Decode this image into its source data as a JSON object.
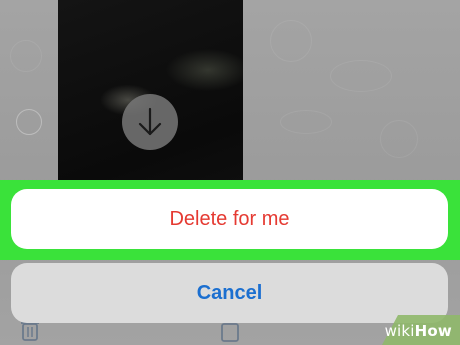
{
  "video": {
    "download_icon": "arrow-down-circle-icon"
  },
  "chat": {
    "select_icon": "empty-circle-icon",
    "bottom_icons": [
      "trash-icon",
      "share-icon"
    ]
  },
  "action_sheet": {
    "delete_label": "Delete for me",
    "cancel_label": "Cancel",
    "highlight_color": "#3ae23a",
    "delete_color": "#e53a32",
    "cancel_color": "#1b6fd0"
  },
  "watermark": {
    "prefix": "wiki",
    "suffix": "How"
  }
}
